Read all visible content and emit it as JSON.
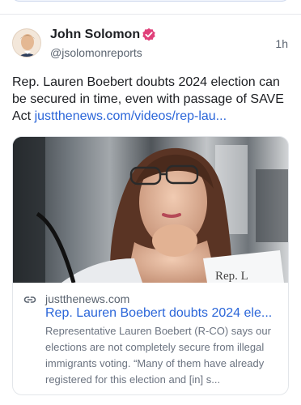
{
  "post": {
    "author_name": "John Solomon",
    "handle": "@jsolomonreports",
    "timestamp": "1h",
    "text": "Rep. Lauren Boebert doubts 2024 election can be secured in time, even with passage of SAVE Act ",
    "link_text": "justthenews.com/videos/rep-lau...",
    "card": {
      "domain": "justthenews.com",
      "title": "Rep. Lauren Boebert doubts 2024 ele...",
      "description": "Representative Lauren Boebert (R-CO) says our elections are not completely secure from illegal immigrants voting. “Many of them have already registered for this election and [in] s..."
    }
  },
  "colors": {
    "link": "#2b66d9",
    "verified_badge": "#e0407a",
    "secondary_text": "#5b6470"
  },
  "icons": {
    "verified": "verified-badge-icon",
    "link": "link-icon"
  }
}
